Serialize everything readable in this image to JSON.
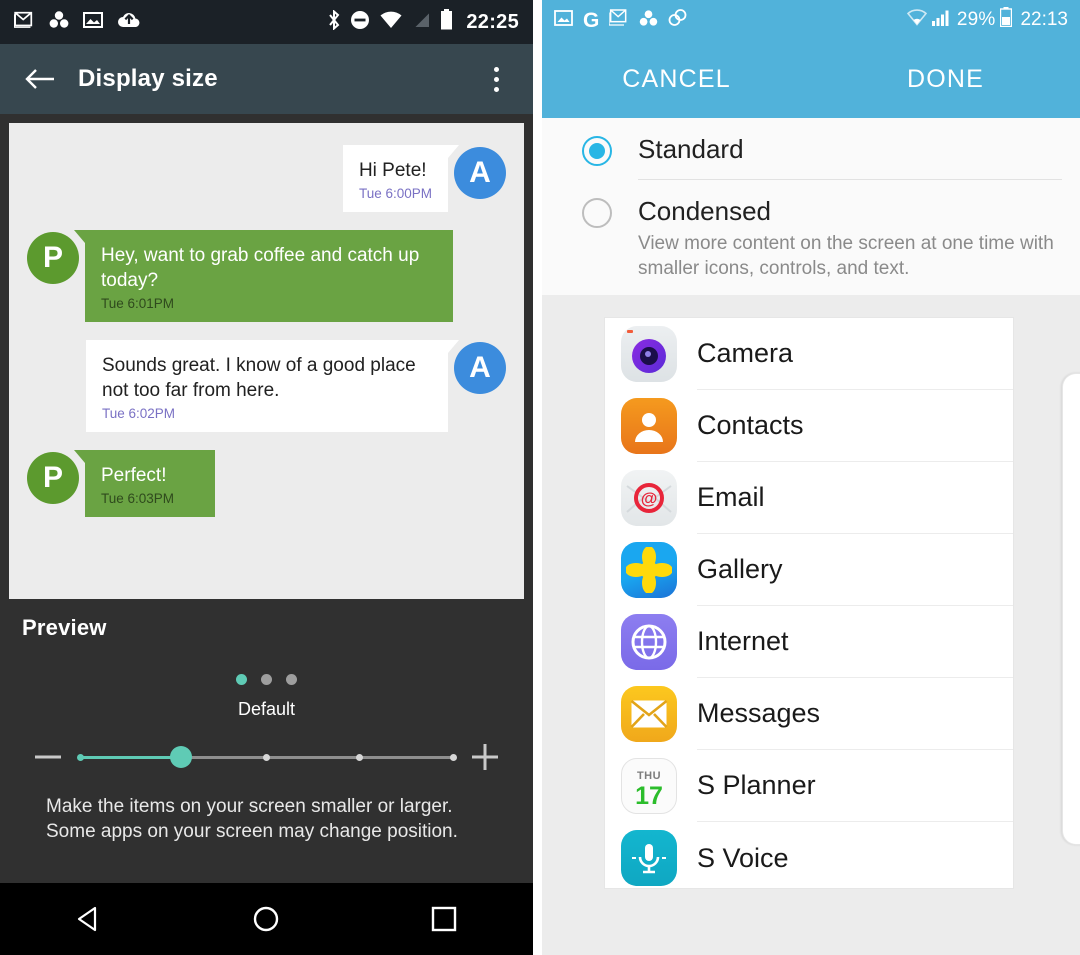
{
  "left_phone": {
    "status_bar": {
      "icons": [
        "gmail-icon",
        "photos-icon",
        "image-icon",
        "cloud-upload-icon"
      ],
      "right_icons": [
        "bluetooth-icon",
        "do-not-disturb-icon",
        "wifi-icon",
        "signal-off-icon",
        "battery-icon"
      ],
      "clock": "22:25"
    },
    "toolbar": {
      "back_label": "back-arrow",
      "title": "Display size",
      "overflow_label": "more-options"
    },
    "chat_preview": {
      "messages": [
        {
          "side": "out",
          "avatar": "A",
          "text": "Hi Pete!",
          "time": "Tue 6:00PM"
        },
        {
          "side": "in",
          "avatar": "P",
          "text": "Hey, want to grab coffee and catch up today?",
          "time": "Tue 6:01PM"
        },
        {
          "side": "out",
          "avatar": "A",
          "text": "Sounds great. I know of a good place not too far from here.",
          "time": "Tue 6:02PM"
        },
        {
          "side": "in",
          "avatar": "P",
          "text": "Perfect!",
          "time": "Tue 6:03PM"
        }
      ]
    },
    "preview": {
      "label": "Preview",
      "page_dots": 3,
      "active_dot": 0,
      "level_label": "Default",
      "slider": {
        "min_label": "−",
        "max_label": "+",
        "steps": 5,
        "value_index": 1
      },
      "help_text": "Make the items on your screen smaller or larger. Some apps on your screen may change position."
    },
    "nav_bar": {
      "back": "back-triangle-icon",
      "home": "home-circle-icon",
      "recents": "recents-square-icon"
    }
  },
  "right_phone": {
    "status_bar": {
      "icons": [
        "image-icon",
        "google-g-icon",
        "gmail-icon",
        "photos-icon",
        "link-icon"
      ],
      "right_icons": [
        "wifi-weak-icon",
        "signal-bars-icon",
        "battery-icon"
      ],
      "battery_percent": "29%",
      "clock": "22:13"
    },
    "action_bar": {
      "cancel_label": "CANCEL",
      "done_label": "DONE"
    },
    "options": [
      {
        "title": "Standard",
        "desc": "",
        "selected": true
      },
      {
        "title": "Condensed",
        "desc": "View more content on the screen at one time with smaller icons, controls, and text.",
        "selected": false
      }
    ],
    "app_preview": {
      "apps": [
        {
          "name": "Camera",
          "icon": "camera-icon"
        },
        {
          "name": "Contacts",
          "icon": "contacts-icon"
        },
        {
          "name": "Email",
          "icon": "email-icon"
        },
        {
          "name": "Gallery",
          "icon": "gallery-icon"
        },
        {
          "name": "Internet",
          "icon": "internet-icon"
        },
        {
          "name": "Messages",
          "icon": "messages-icon"
        },
        {
          "name": "S Planner",
          "icon": "s-planner-icon",
          "day": "THU",
          "date": "17"
        },
        {
          "name": "S Voice",
          "icon": "s-voice-icon"
        }
      ]
    }
  },
  "colors": {
    "left_status_bar": "#1b2127",
    "left_toolbar": "#37474f",
    "left_body": "#303030",
    "chat_background": "#ececec",
    "bubble_green": "#6aa343",
    "avatar_blue": "#3c8cdd",
    "avatar_green": "#5c9a2e",
    "slider_accent": "#5fcbb5",
    "right_accent": "#51b2da",
    "radio_selected": "#28b6e5"
  }
}
